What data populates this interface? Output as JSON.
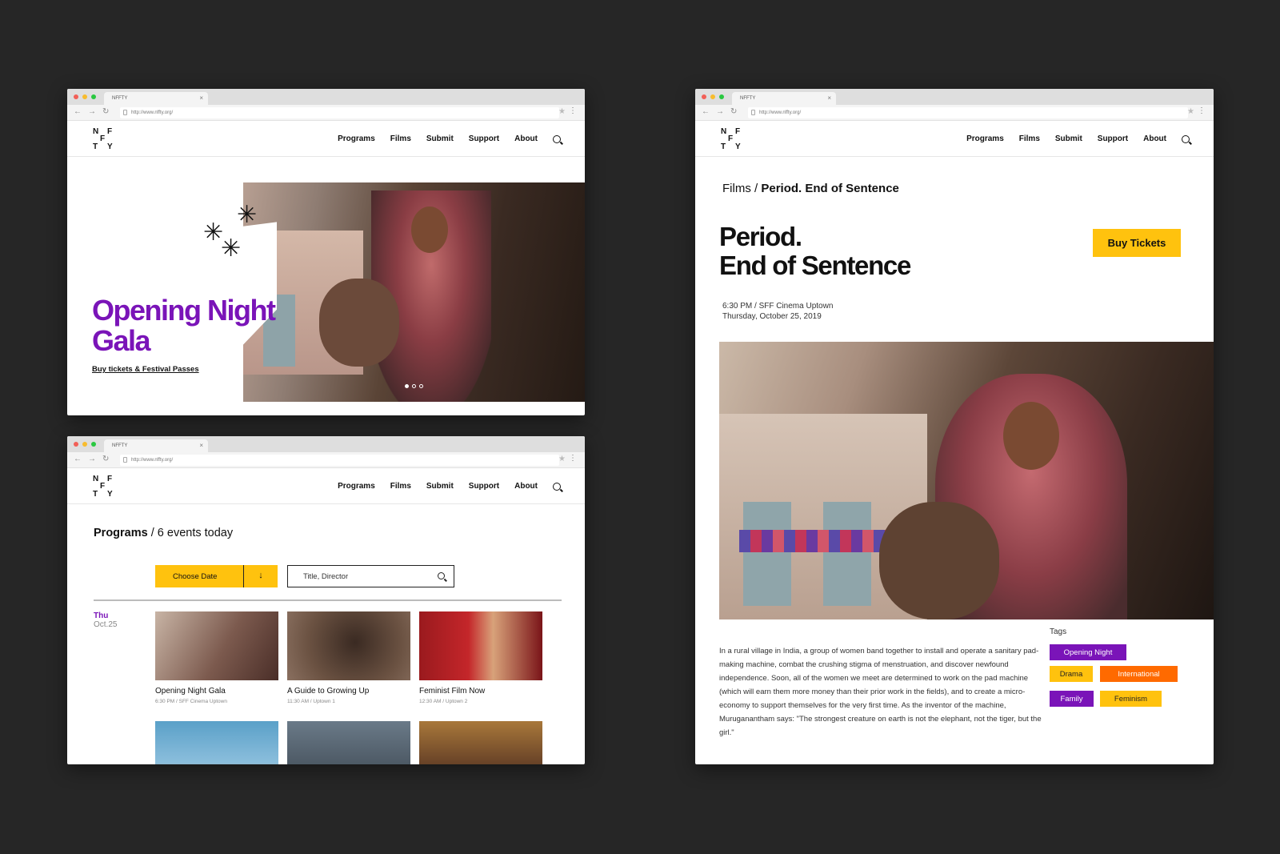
{
  "browser": {
    "tab_title": "NFFTY",
    "url": "http://www.nffty.org/"
  },
  "logo": {
    "l1": "N",
    "l2": "F",
    "l3": "F",
    "l4": "T",
    "l5": "Y"
  },
  "nav": {
    "programs": "Programs",
    "films": "Films",
    "submit": "Submit",
    "support": "Support",
    "about": "About"
  },
  "home": {
    "title_line1": "Opening Night",
    "title_line2": "Gala",
    "link": "Buy tickets & Festival Passes"
  },
  "programs_page": {
    "heading": "Programs",
    "subheading": "/ 6 events today",
    "choose_date": "Choose Date",
    "search_placeholder": "Title, Director",
    "day_name": "Thu",
    "day_date": "Oct.25",
    "events": [
      {
        "title": "Opening Night Gala",
        "meta": "6:30 PM / SFF Cinema Uptown"
      },
      {
        "title": "A Guide to Growing Up",
        "meta": "11:30 AM / Uptown 1"
      },
      {
        "title": "Feminist Film Now",
        "meta": "12:30 AM / Uptown 2"
      }
    ]
  },
  "film_page": {
    "crumb_parent": "Films",
    "crumb_current": "Period. End of Sentence",
    "title_line1": "Period.",
    "title_line2": "End of Sentence",
    "buy": "Buy Tickets",
    "when_line1": "6:30 PM / SFF Cinema Uptown",
    "when_line2": "Thursday, October 25, 2019",
    "description": "In a rural village in India, a group of women band together to install and operate a sanitary pad-making machine, combat the crushing stigma of menstruation, and discover newfound independence. Soon, all of the women we meet are determined to work on the pad machine (which will earn them more money than their prior work in the fields), and to create a micro-economy to support themselves for the very first time.  As the inventor of the machine, Muruganantham says: \"The strongest creature on earth is not the elephant, not the tiger, but the girl.\"",
    "tags_label": "Tags",
    "tags": [
      "Opening Night",
      "Drama",
      "International",
      "Family",
      "Feminism"
    ]
  },
  "colors": {
    "accent_purple": "#7a14b8",
    "accent_yellow": "#ffc20e",
    "accent_orange": "#ff6a00",
    "backdrop": "#262626"
  }
}
